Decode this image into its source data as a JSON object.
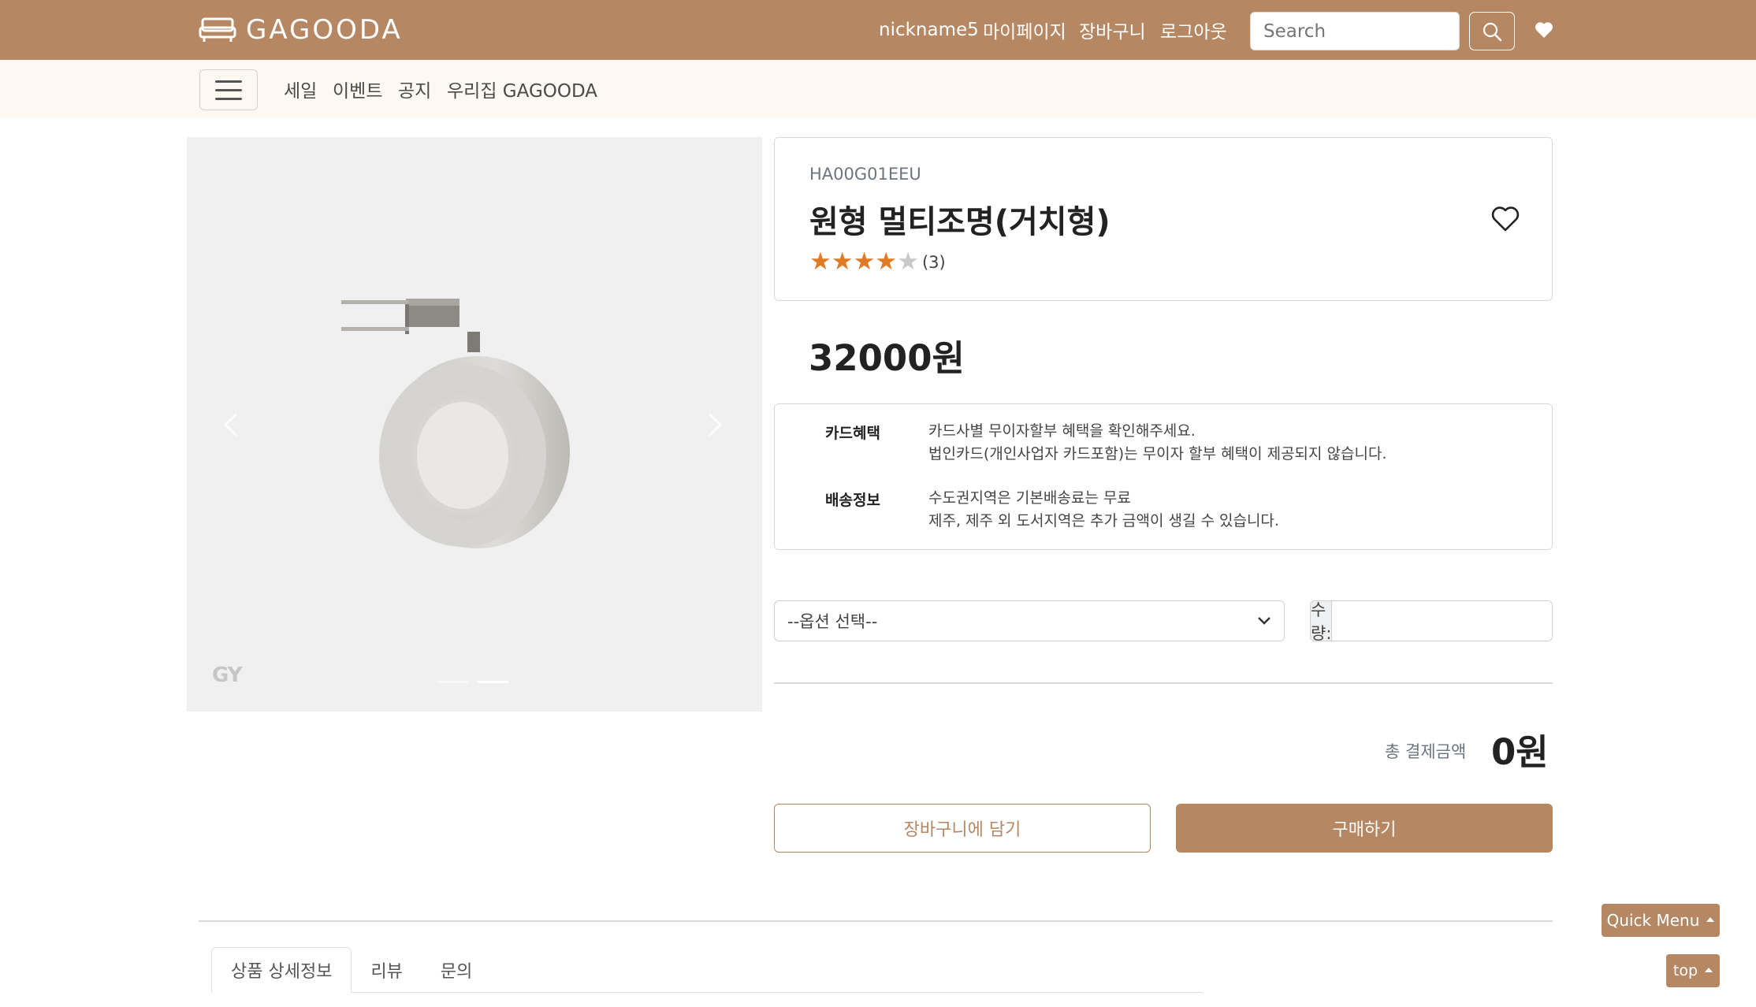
{
  "colors": {
    "brand": "#b58863",
    "subbar": "#fdf8f2",
    "star": "#e07a24"
  },
  "header": {
    "logo_text": "GAGOODA",
    "nickname": "nickname5",
    "mypage": "마이페이지",
    "cart": "장바구니",
    "logout": "로그아웃",
    "search_placeholder": "Search",
    "icons": [
      "sofa-logo-icon",
      "search-icon",
      "heart-icon"
    ]
  },
  "subnav": {
    "items": [
      "세일",
      "이벤트",
      "공지",
      "우리집 GAGOODA"
    ],
    "menu_icon": "hamburger-icon"
  },
  "gallery": {
    "watermark": "GY",
    "slide_count": 2,
    "active_slide": 2
  },
  "product": {
    "sku": "HA00G01EEU",
    "name": "원형 멀티조명(거치형)",
    "rating": 4,
    "rating_max": 5,
    "review_count": "(3)",
    "price": "32000원"
  },
  "benefits": {
    "card_label": "카드혜택",
    "card_line1": "카드사별 무이자할부 혜택을 확인해주세요.",
    "card_line2": "법인카드(개인사업자 카드포함)는 무이자 할부 혜택이 제공되지 않습니다.",
    "ship_label": "배송정보",
    "ship_line1": "수도권지역은 기본배송료는 무료",
    "ship_line2": "제주, 제주 외 도서지역은 추가 금액이 생길 수 있습니다."
  },
  "order": {
    "option_placeholder": "--옵션 선택--",
    "qty_label": "수량:",
    "qty_value": "",
    "total_label": "총 결제금액",
    "total_value": "0원",
    "cart_button": "장바구니에 담기",
    "buy_button": "구매하기"
  },
  "tabs": [
    "상품 상세정보",
    "리뷰",
    "문의"
  ],
  "floating": {
    "quick_menu": "Quick Menu",
    "top": "top"
  }
}
